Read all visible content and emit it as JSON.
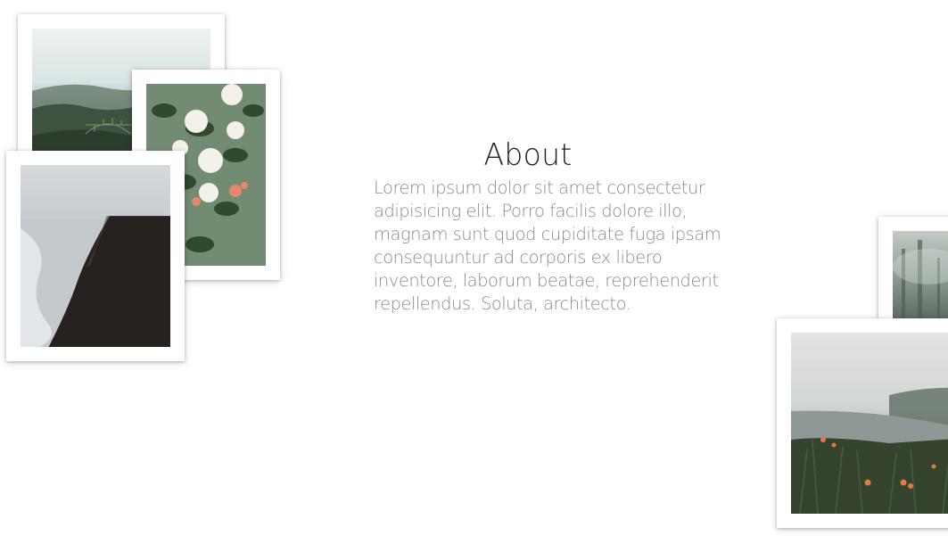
{
  "about": {
    "title": "About",
    "body": "Lorem ipsum dolor sit amet consectetur adipisicing elit. Porro facilis dolore illo, magnam sunt quod cupiditate fuga ipsam consequuntur ad corporis ex libero inventore, laborum beatae, reprehenderit repellendus. Soluta, architecto."
  },
  "colors": {
    "background": "#ffffff",
    "title": "#222222",
    "body_text": "#8a8a8a"
  }
}
